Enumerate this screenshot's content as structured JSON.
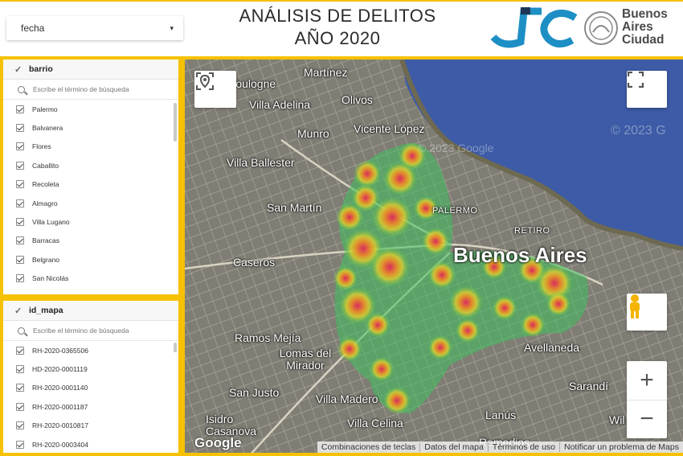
{
  "header": {
    "date_filter_label": "fecha",
    "title_line1": "ANÁLISIS DE DELITOS",
    "title_line2": "AÑO 2020",
    "city_logo_line1": "Buenos",
    "city_logo_line2": "Aires",
    "city_logo_line3": "Ciudad",
    "brand_colors": {
      "jc_blue": "#1d8fc4",
      "jc_navy": "#1d3557",
      "accent_yellow": "#f6c100"
    }
  },
  "filters": {
    "barrio": {
      "title": "barrio",
      "search_placeholder": "Escribe el término de búsqueda",
      "items": [
        "Palermo",
        "Balvanera",
        "Flores",
        "Caballito",
        "Recoleta",
        "Almagro",
        "Villa Lugano",
        "Barracas",
        "Belgrano",
        "San Nicolás"
      ]
    },
    "id_mapa": {
      "title": "id_mapa",
      "search_placeholder": "Escribe el término de búsqueda",
      "items": [
        "RH-2020-0365506",
        "HD-2020-0001119",
        "RH-2020-0001140",
        "RH-2020-0001187",
        "RH-2020-0010817",
        "RH-2020-0003404"
      ]
    }
  },
  "map": {
    "labels": [
      "Martínez",
      "Boulogne",
      "Villa Adelina",
      "Olivos",
      "Munro",
      "Vicente López",
      "Villa Ballester",
      "San Martín",
      "PALERMO",
      "RETIRO",
      "Caseros",
      "Buenos Aires",
      "Ramos Mejía",
      "Lomas del Mirador",
      "Avellaneda",
      "San Justo",
      "Villa Madero",
      "Sarandí",
      "Isidro Casanova",
      "Villa Celina",
      "Lanús",
      "Remedios",
      "Wil"
    ],
    "watermark": "© 2023 Google",
    "watermark2": "© 2023 G",
    "google_logo": "Google",
    "zoom_in": "+",
    "zoom_out": "−",
    "footer": [
      "Combinaciones de teclas",
      "Datos del mapa",
      "Términos de uso",
      "Notificar un problema de Maps"
    ],
    "icons": [
      "location-pin-icon",
      "fullscreen-icon",
      "pegman-icon"
    ]
  }
}
